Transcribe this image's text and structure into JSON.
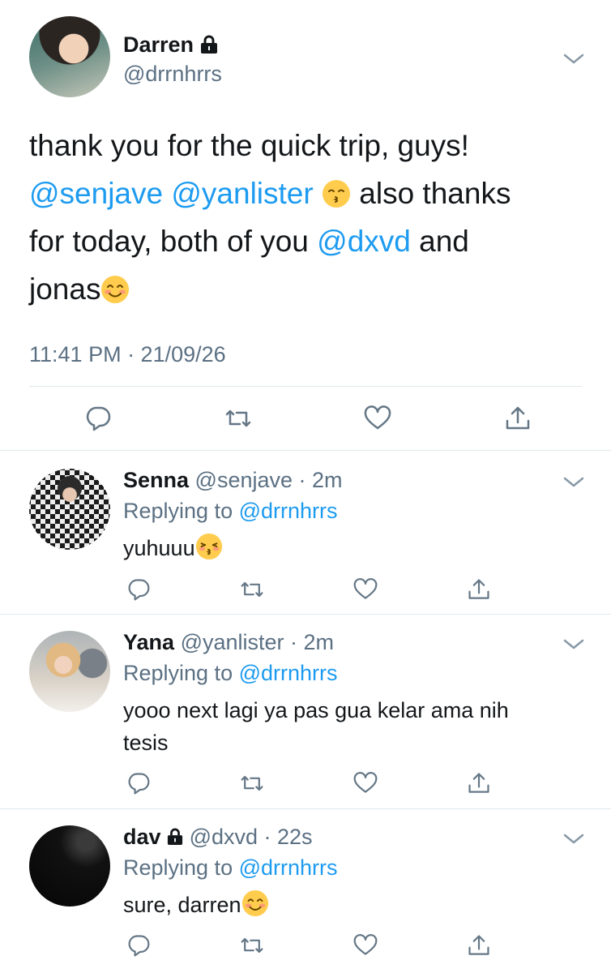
{
  "main_tweet": {
    "name": "Darren",
    "handle": "@drrnhrrs",
    "locked_icon": "lock-icon",
    "text": {
      "line1": "thank you for the quick trip, guys!",
      "mention1": "@senjave",
      "mention2": "@yanlister",
      "mid": " also thanks",
      "line3a": "for today, both of you ",
      "mention3": "@dxvd",
      "line3b": " and",
      "line4": "jonas"
    },
    "timestamp": "11:41 PM · 21/09/26",
    "emoji": [
      "kissing-face-with-smiling-eyes",
      "smiling-face-with-smiling-eyes"
    ]
  },
  "actions": [
    "reply-icon",
    "retweet-icon",
    "like-icon",
    "share-icon"
  ],
  "replies": [
    {
      "name": "Senna",
      "handle": "@senjave",
      "time": "2m",
      "replying_label": "Replying to ",
      "replying_to": "@drrnhrrs",
      "text": "yuhuuu",
      "emoji": "kissing-face-with-closed-eyes"
    },
    {
      "name": "Yana",
      "handle": "@yanlister",
      "time": "2m",
      "replying_label": "Replying to ",
      "replying_to": "@drrnhrrs",
      "text": "yooo next lagi ya pas gua kelar ama nih tesis"
    },
    {
      "name": "dav",
      "handle": "@dxvd",
      "time": "22s",
      "locked": true,
      "replying_label": "Replying to ",
      "replying_to": "@drrnhrrs",
      "text": "sure, darren",
      "emoji": "smiling-face-with-smiling-eyes"
    }
  ],
  "colors": {
    "link": "#1d9bf0",
    "secondary": "#5b7083",
    "divider": "#e1e8ed"
  }
}
